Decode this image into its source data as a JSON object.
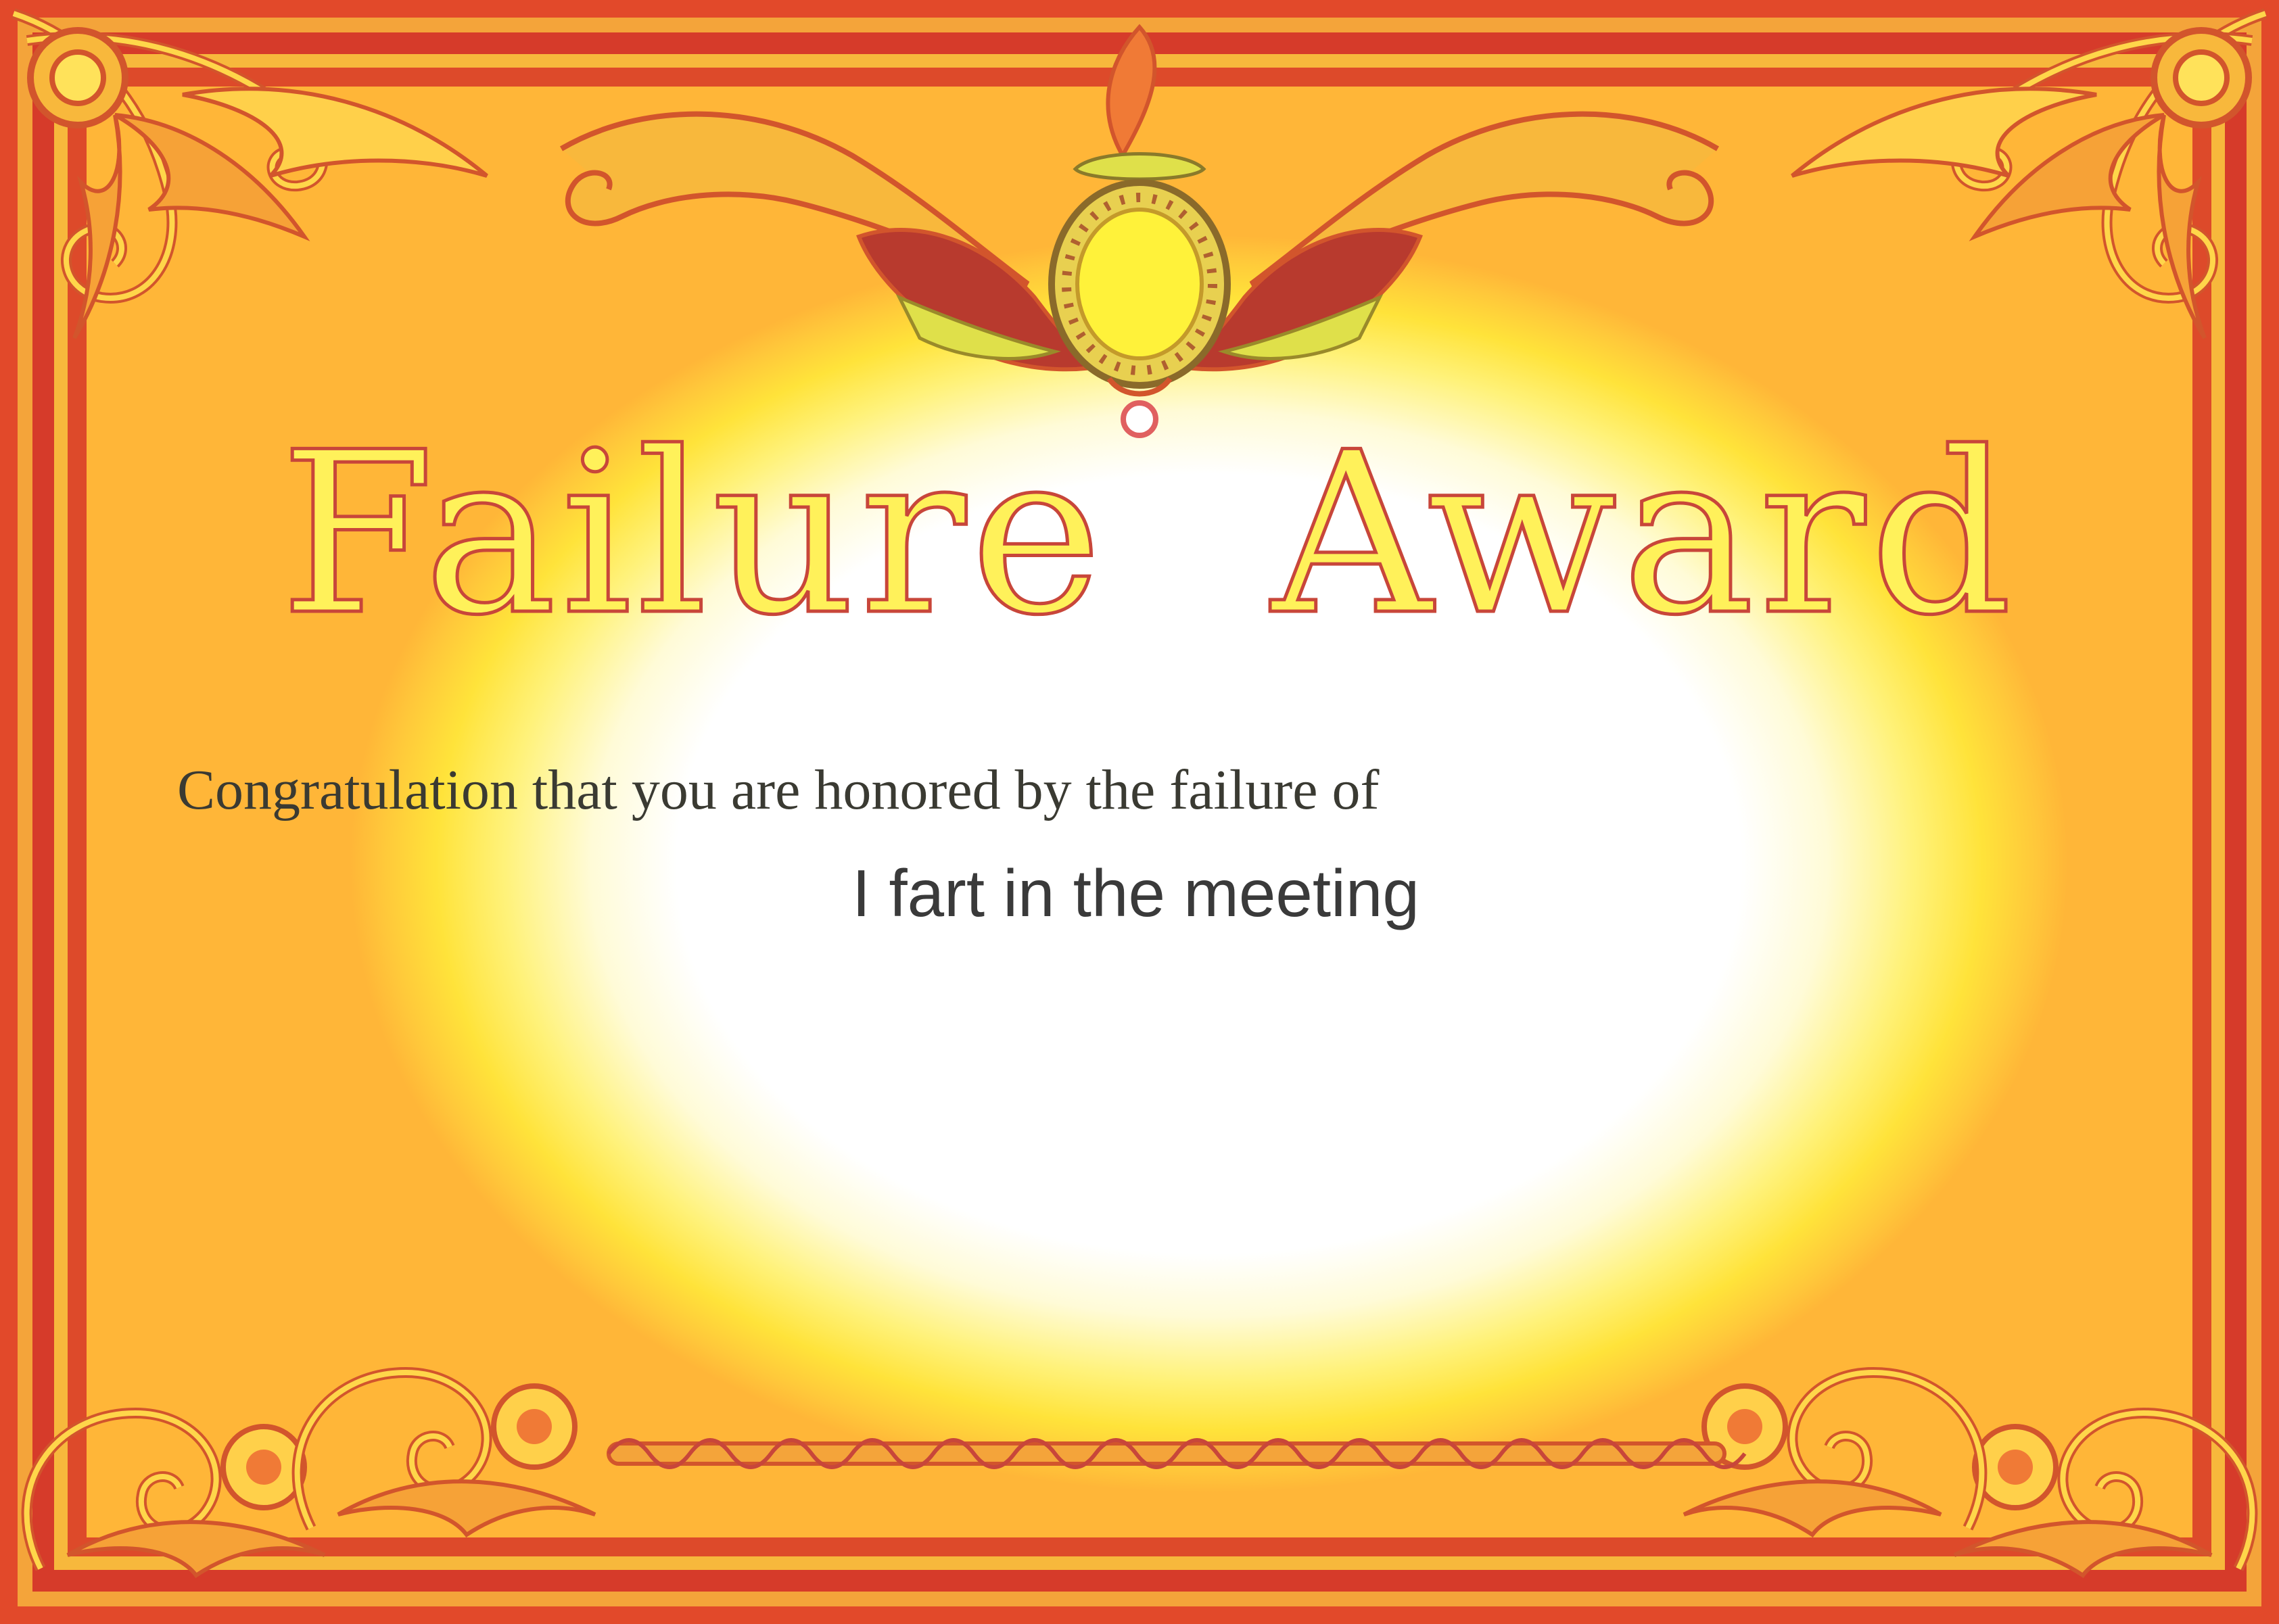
{
  "certificate": {
    "title_word_1": "Failure",
    "title_word_2": "Award",
    "congratulation_line": "Congratulation that you are honored by the failure of",
    "reason": "I fart in the meeting"
  },
  "colors": {
    "border_red": "#d63b2a",
    "border_orange": "#f0612b",
    "gold": "#f7b83c",
    "title_fill": "#fff15a",
    "title_outline": "#c8463a",
    "text": "#3a3a32"
  },
  "icons": [
    "top-crest-icon",
    "corner-scroll-icon",
    "bottom-flourish-icon"
  ]
}
